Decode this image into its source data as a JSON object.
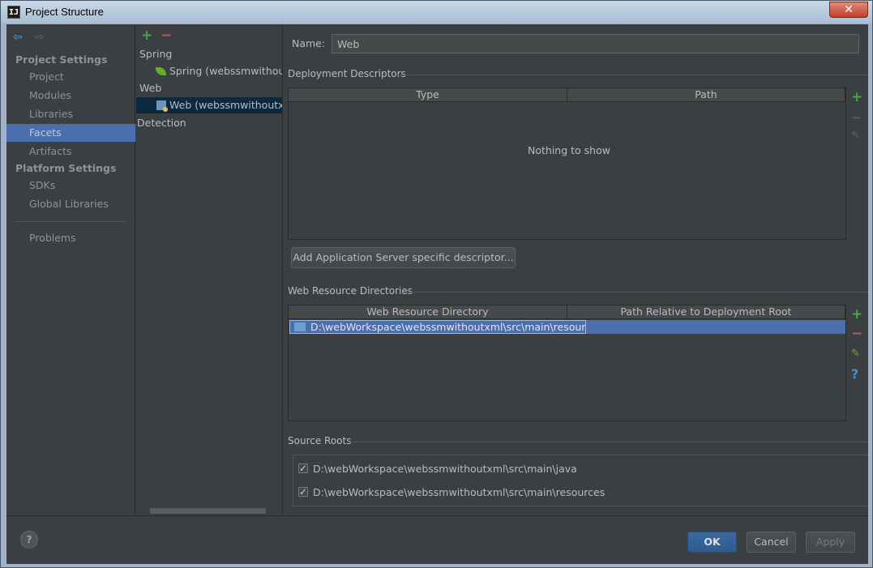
{
  "window": {
    "title": "Project Structure",
    "app_icon": "IJ",
    "close_glyph": "✕"
  },
  "nav": {
    "back_glyph": "⇦",
    "forward_glyph": "⇨",
    "project_settings_label": "Project Settings",
    "platform_settings_label": "Platform Settings",
    "items": [
      {
        "label": "Project"
      },
      {
        "label": "Modules"
      },
      {
        "label": "Libraries"
      },
      {
        "label": "Facets",
        "selected": true
      },
      {
        "label": "Artifacts"
      },
      {
        "label": "SDKs"
      },
      {
        "label": "Global Libraries"
      },
      {
        "label": "Problems"
      }
    ]
  },
  "tree": {
    "add_glyph": "+",
    "remove_glyph": "−",
    "spring_label": "Spring",
    "spring_child": "Spring (webssmwithoutxml)",
    "web_label": "Web",
    "web_child": "Web (webssmwithoutxml)",
    "detection_label": "Detection"
  },
  "facet": {
    "name_label": "Name:",
    "name_value": "Web",
    "deployment_title": "Deployment Descriptors",
    "deployment_columns": [
      "Type",
      "Path"
    ],
    "deployment_empty": "Nothing to show",
    "add_descriptor_button": "Add Application Server specific descriptor...",
    "web_resource_title": "Web Resource Directories",
    "web_resource_columns": [
      "Web Resource Directory",
      "Path Relative to Deployment Root"
    ],
    "web_resource_rows": [
      {
        "directory": "D:\\webWorkspace\\webssmwithoutxml\\src\\main\\resources",
        "path": ""
      }
    ],
    "source_roots_title": "Source Roots",
    "source_roots": [
      {
        "path": "D:\\webWorkspace\\webssmwithoutxml\\src\\main\\java",
        "checked": true
      },
      {
        "path": "D:\\webWorkspace\\webssmwithoutxml\\src\\main\\resources",
        "checked": true
      }
    ],
    "tool_glyphs": {
      "add": "+",
      "remove": "−",
      "edit": "✎",
      "help": "?"
    }
  },
  "footer": {
    "help_glyph": "?",
    "ok": "OK",
    "cancel": "Cancel",
    "apply": "Apply"
  },
  "colors": {
    "background": "#3c3f41",
    "selection": "#4b6eaf",
    "add": "#3fa84f",
    "remove": "#c75450"
  }
}
